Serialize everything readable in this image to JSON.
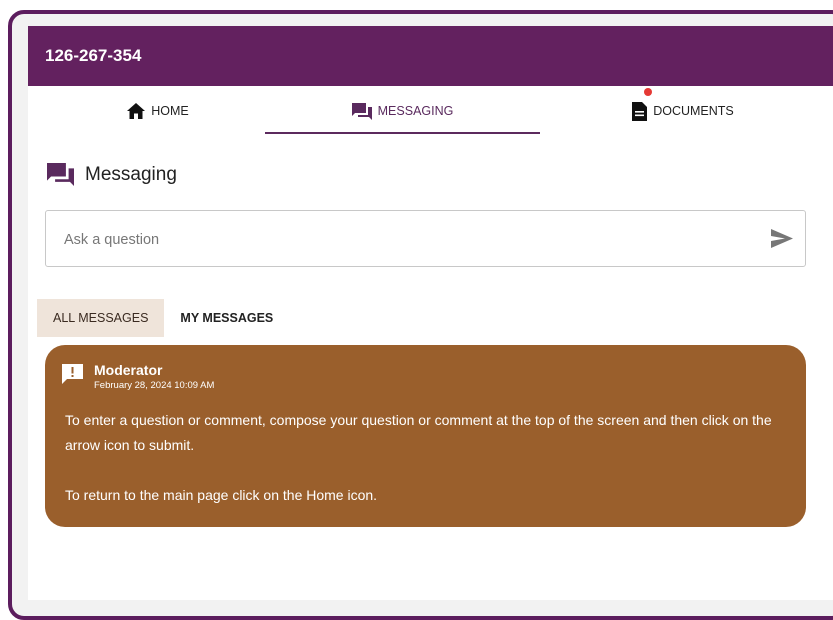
{
  "header": {
    "meeting_id": "126-267-354",
    "accent_color": "#63215f"
  },
  "nav": {
    "tabs": [
      {
        "label": "HOME",
        "icon": "home-icon"
      },
      {
        "label": "MESSAGING",
        "icon": "chat-icon",
        "active": true
      },
      {
        "label": "DOCUMENTS",
        "icon": "document-icon",
        "notification": true
      }
    ]
  },
  "section": {
    "title": "Messaging",
    "icon": "chat-icon"
  },
  "ask": {
    "placeholder": "Ask a question",
    "value": ""
  },
  "filters": {
    "all_label": "ALL MESSAGES",
    "my_label": "MY MESSAGES",
    "active": "ALL MESSAGES"
  },
  "messages": [
    {
      "author": "Moderator",
      "date": "February 28, 2024 10:09 AM",
      "icon": "alert-message-icon",
      "paragraphs": [
        "To enter a question or comment, compose your question or comment at the top of the screen and then click on the arrow icon to submit.",
        "To return to the main page click on the Home icon."
      ],
      "color": "#9a5f2c"
    }
  ]
}
